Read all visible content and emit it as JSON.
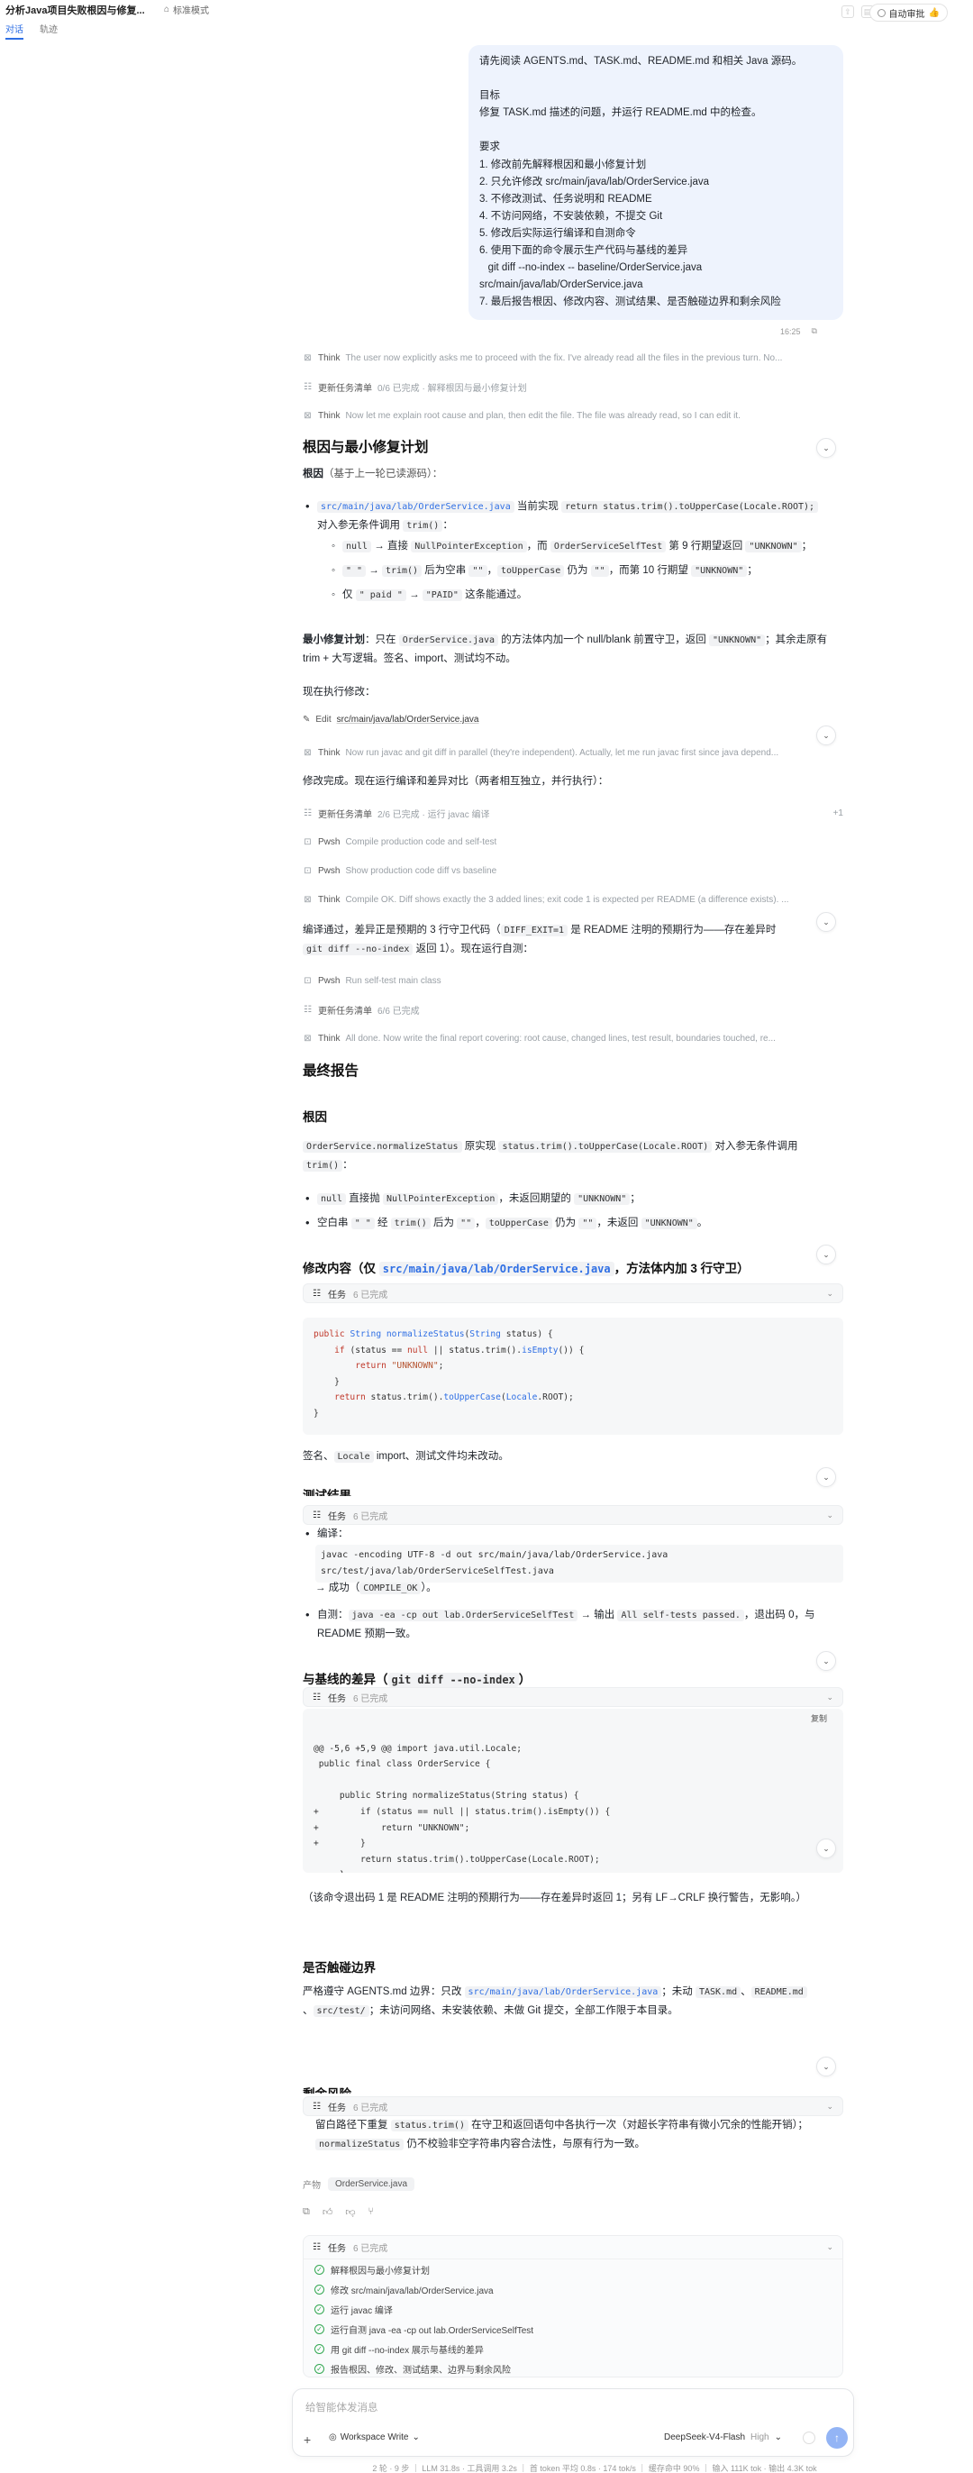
{
  "header": {
    "title": "分析Java项目失败根因与修复...",
    "mode_label": "标准模式",
    "tabs": [
      "对话",
      "轨迹"
    ],
    "auto_approve_label": "自动审批",
    "auto_approve_emoji": "👍"
  },
  "user_message": {
    "lines": [
      "请先阅读 AGENTS.md、TASK.md、README.md 和相关 Java 源码。",
      "",
      "目标",
      "修复 TASK.md 描述的问题，并运行 README.md 中的检查。",
      "",
      "要求",
      "1. 修改前先解释根因和最小修复计划",
      "2. 只允许修改 src/main/java/lab/OrderService.java",
      "3. 不修改测试、任务说明和 README",
      "4. 不访问网络，不安装依赖，不提交 Git",
      "5. 修改后实际运行编译和自测命令",
      "6. 使用下面的命令展示生产代码与基线的差异",
      "   git diff --no-index -- baseline/OrderService.java",
      "src/main/java/lab/OrderService.java",
      "7. 最后报告根因、修改内容、测试结果、是否触碰边界和剩余风险"
    ],
    "time": "16:25"
  },
  "activity": {
    "think1_label": "Think",
    "think1_text": "The user now explicitly asks me to proceed with the fix. I've already read all the files in the previous turn. No...",
    "todo1_label": "更新任务清单",
    "todo1_text": "0/6 已完成 · 解释根因与最小修复计划",
    "think2_label": "Think",
    "think2_text": "Now let me explain root cause and plan, then edit the file. The file was already read, so I can edit it.",
    "edit_label": "Edit",
    "edit_file": "src/main/java/lab/OrderService.java",
    "think3_label": "Think",
    "think3_text": "Now run javac and git diff in parallel (they're independent). Actually, let me run javac first since java depend...",
    "todo2_label": "更新任务清单",
    "todo2_text": "2/6 已完成 · 运行 javac 编译",
    "todo2_right": "+1",
    "pwsh1_label": "Pwsh",
    "pwsh1_text": "Compile production code and self-test",
    "pwsh2_label": "Pwsh",
    "pwsh2_text": "Show production code diff vs baseline",
    "think4_label": "Think",
    "think4_text": "Compile OK. Diff shows exactly the 3 added lines; exit code 1 is expected per README (a difference exists). ...",
    "pwsh3_label": "Pwsh",
    "pwsh3_text": "Run self-test main class",
    "todo3_label": "更新任务清单",
    "todo3_text": "6/6 已完成",
    "think5_label": "Think",
    "think5_text": "All done. Now write the final report covering: root cause, changed lines, test result, boundaries touched, re..."
  },
  "section1": {
    "heading": "根因与最小修复计划",
    "root_label": "根因",
    "root_note": "（基于上一轮已读源码）：",
    "b1_path": "src/main/java/lab/OrderService.java",
    "b1_mid": " 当前实现 ",
    "b1_code": "return status.trim().toUpperCase(Locale.ROOT);",
    "b1_tail1": "对入参无条件调用 ",
    "b1_code2": "trim()",
    "b1_tail2": "：",
    "s1_c1": "null",
    "s1_t1": " → 直接 ",
    "s1_c2": "NullPointerException",
    "s1_t2": "，而 ",
    "s1_c3": "OrderServiceSelfTest",
    "s1_t3": " 第 9 行期望返回 ",
    "s1_c4": "\"UNKNOWN\"",
    "s1_t4": "；",
    "s2_c1": "\" \"",
    "s2_t1": " → ",
    "s2_c2": "trim()",
    "s2_t2": " 后为空串 ",
    "s2_c3": "\"\"",
    "s2_t3": "，",
    "s2_c4": "toUpperCase",
    "s2_t4": " 仍为 ",
    "s2_c5": "\"\"",
    "s2_t5": "，而第 10 行期望 ",
    "s2_c6": "\"UNKNOWN\"",
    "s2_t6": "；",
    "s3_t1": "仅 ",
    "s3_c1": "\" paid \"",
    "s3_t2": " → ",
    "s3_c2": "\"PAID\"",
    "s3_t3": " 这条能通过。",
    "plan_label": "最小修复计划",
    "plan_t1": "：只在 ",
    "plan_c1": "OrderService.java",
    "plan_t2": " 的方法体内加一个 null/blank 前置守卫，返回 ",
    "plan_c2": "\"UNKNOWN\"",
    "plan_t3": "；其余走原有 trim + 大写逻辑。签名、import、测试均不动。",
    "executing": "现在执行修改：",
    "after_edit": "修改完成。现在运行编译和差异对比（两者相互独立，并行执行）：",
    "compile_t1": "编译通过，差异正是预期的 3 行守卫代码（",
    "compile_c1": "DIFF_EXIT=1",
    "compile_t2": " 是 README 注明的预期行为——存在差异时 ",
    "compile_c2": "git diff --no-index",
    "compile_t3": " 返回 1）。现在运行自测："
  },
  "report": {
    "heading": "最终报告",
    "root_heading": "根因",
    "root_c1": "OrderService.normalizeStatus",
    "root_t1": " 原实现 ",
    "root_c2": "status.trim().toUpperCase(Locale.ROOT)",
    "root_t2": " 对入参无条件调用 ",
    "root_c3": "trim()",
    "root_t3": "：",
    "rb1_c1": "null",
    "rb1_t1": " 直接抛 ",
    "rb1_c2": "NullPointerException",
    "rb1_t2": "，未返回期望的 ",
    "rb1_c3": "\"UNKNOWN\"",
    "rb1_t3": "；",
    "rb2_t1": "空白串 ",
    "rb2_c1": "\" \"",
    "rb2_t2": " 经 ",
    "rb2_c2": "trim()",
    "rb2_t3": " 后为 ",
    "rb2_c3": "\"\"",
    "rb2_t4": "，",
    "rb2_c4": "toUpperCase",
    "rb2_t5": " 仍为 ",
    "rb2_c5": "\"\"",
    "rb2_t6": "，未返回 ",
    "rb2_c6": "\"UNKNOWN\"",
    "rb2_t7": "。",
    "change_h1": "修改内容（仅 ",
    "change_path": "src/main/java/lab/OrderService.java",
    "change_h2": "，方法体内加 3 行守卫）",
    "code_lines": [
      "public String normalizeStatus(String status) {",
      "    if (status == null || status.trim().isEmpty()) {",
      "        return \"UNKNOWN\";",
      "    }",
      "    return status.trim().toUpperCase(Locale.ROOT);",
      "}"
    ],
    "unchanged_t1": "签名、",
    "unchanged_c1": "Locale",
    "unchanged_t2": " import、测试文件均未改动。",
    "test_heading": "测试结果",
    "compile_label": "编译：",
    "compile_cmd": "javac -encoding UTF-8 -d out src/main/java/lab/OrderService.java\nsrc/test/java/lab/OrderServiceSelfTest.java",
    "compile_ok_t1": "→ 成功（",
    "compile_ok_c": "COMPILE_OK",
    "compile_ok_t2": "）。",
    "selftest_t1": "自测：",
    "selftest_c1": "java -ea -cp out lab.OrderServiceSelfTest",
    "selftest_t2": " → 输出 ",
    "selftest_c2": "All self-tests passed.",
    "selftest_t3": "，退出码 0，与 README 预期一致。",
    "diff_h1": "与基线的差异（",
    "diff_c": "git diff --no-index",
    "diff_h2": "）",
    "copy_label": "复制",
    "diff_lines": [
      "",
      "@@ -5,6 +5,9 @@ import java.util.Locale;",
      " public final class OrderService {",
      "",
      "     public String normalizeStatus(String status) {",
      "+        if (status == null || status.trim().isEmpty()) {",
      "+            return \"UNKNOWN\";",
      "+        }",
      "         return status.trim().toUpperCase(Locale.ROOT);",
      "     }",
      " }"
    ],
    "diff_note": "（该命令退出码 1 是 README 注明的预期行为——存在差异时返回 1；另有 LF→CRLF 换行警告，无影响。）",
    "boundary_heading": "是否触碰边界",
    "boundary_t1": "严格遵守 AGENTS.md 边界：只改 ",
    "boundary_c1": "src/main/java/lab/OrderService.java",
    "boundary_t2": "；未动 ",
    "boundary_c2": "TASK.md",
    "boundary_t3": "、",
    "boundary_c3": "README.md",
    "boundary_t4": "、",
    "boundary_c4": "src/test/",
    "boundary_t5": "；未访问网络、未安装依赖、未做 Git 提交，全部工作限于本目录。",
    "risk_heading": "剩余风险",
    "risk_t1": "留白路径下重复 ",
    "risk_c1": "status.trim()",
    "risk_t2": " 在守卫和返回语句中各执行一次（对超长字符串有微小冗余的性能开销）；",
    "risk_c2": "normalizeStatus",
    "risk_t3": " 仍不校验非空字符串内容合法性，与原有行为一致。"
  },
  "task_float": {
    "label": "任务",
    "count": "6 已完成"
  },
  "artifact": {
    "label": "产物",
    "file": "OrderService.java"
  },
  "task_panel": {
    "label": "任务",
    "count": "6 已完成",
    "items": [
      "解释根因与最小修复计划",
      "修改 src/main/java/lab/OrderService.java",
      "运行 javac 编译",
      "运行自测 java -ea -cp out lab.OrderServiceSelfTest",
      "用 git diff --no-index 展示与基线的差异",
      "报告根因、修改、测试结果、边界与剩余风险"
    ]
  },
  "composer": {
    "placeholder": "给智能体发消息",
    "workspace": "Workspace Write",
    "model": "DeepSeek-V4-Flash",
    "level": "High"
  },
  "statusbar": "2 轮 · 9 步 ｜ LLM 31.8s · 工具调用 3.2s ｜ 首 token 平均 0.8s · 174 tok/s ｜ 缓存命中 90% ｜ 输入 111K tok · 输出 4.3K tok"
}
